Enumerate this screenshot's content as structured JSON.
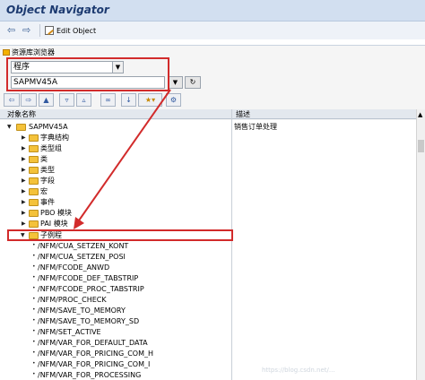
{
  "title": "Object Navigator",
  "toolbar": {
    "back_icon": "left-arrow-icon",
    "forward_icon": "right-arrow-icon",
    "edit_label": "Edit Object"
  },
  "panel": {
    "header": "资源库浏览器",
    "type_value": "程序",
    "search_value": "SAPMV45A"
  },
  "columns": {
    "name": "对象名称",
    "desc": "描述"
  },
  "tree": {
    "root": {
      "label": "SAPMV45A",
      "desc": "销售订单处理"
    },
    "folders": [
      {
        "label": "字典结构"
      },
      {
        "label": "类型组"
      },
      {
        "label": "类"
      },
      {
        "label": "类型"
      },
      {
        "label": "字段"
      },
      {
        "label": "宏"
      },
      {
        "label": "事件"
      },
      {
        "label": "PBO 模块"
      },
      {
        "label": "PAI 模块"
      },
      {
        "label": "子例程"
      }
    ],
    "subroutines": [
      "/NFM/CUA_SETZEN_KONT",
      "/NFM/CUA_SETZEN_POSI",
      "/NFM/FCODE_ANWD",
      "/NFM/FCODE_DEF_TABSTRIP",
      "/NFM/FCODE_PROC_TABSTRIP",
      "/NFM/PROC_CHECK",
      "/NFM/SAVE_TO_MEMORY",
      "/NFM/SAVE_TO_MEMORY_SD",
      "/NFM/SET_ACTIVE",
      "/NFM/VAR_FOR_DEFAULT_DATA",
      "/NFM/VAR_FOR_PRICING_COM_H",
      "/NFM/VAR_FOR_PRICING_COM_I",
      "/NFM/VAR_FOR_PROCESSING"
    ]
  },
  "watermark": "https://blog.csdn.net/..."
}
